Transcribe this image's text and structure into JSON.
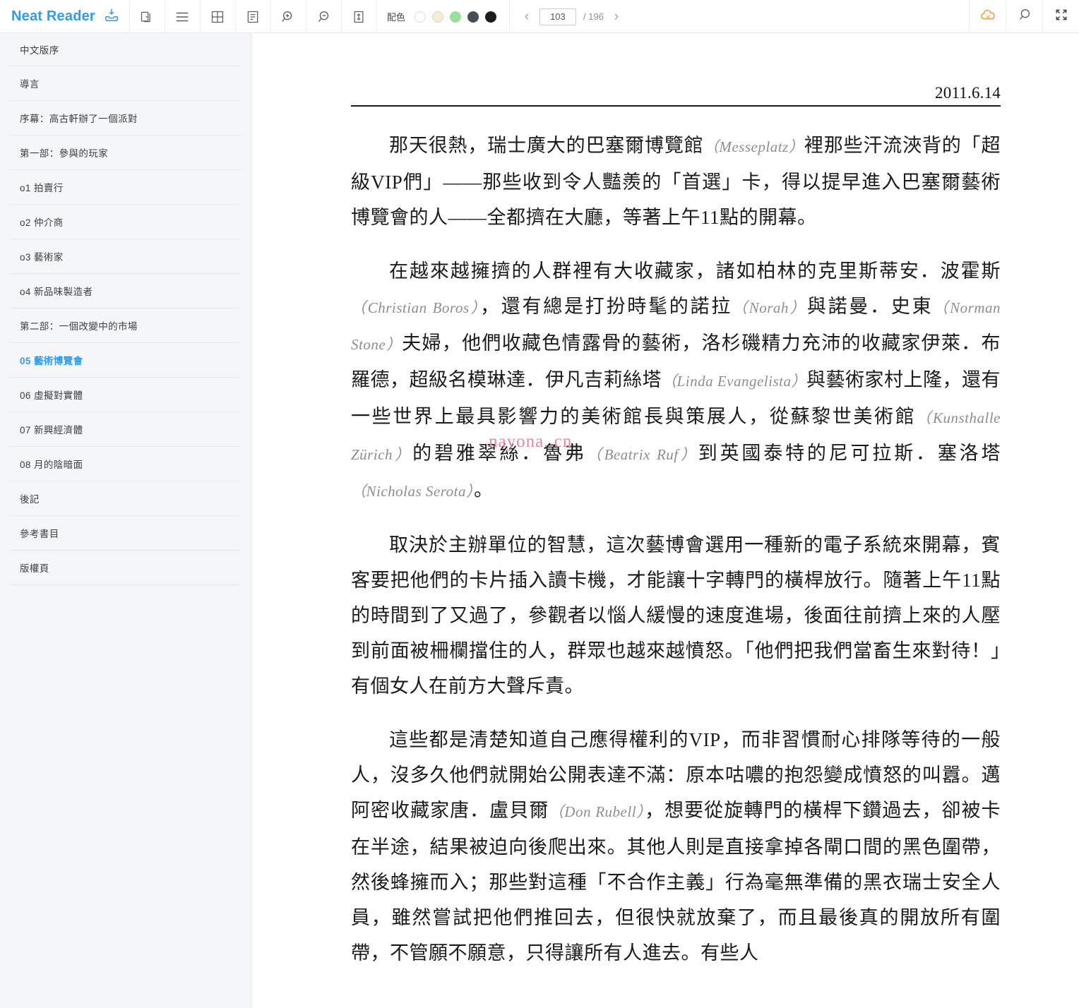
{
  "app": {
    "brand_name": "Neat Reader"
  },
  "toolbar": {
    "icons": [
      {
        "name": "save-to-library-icon",
        "label": "save-to-library"
      },
      {
        "name": "copy-book-icon",
        "label": "book-shelf"
      },
      {
        "name": "hamburger-menu-icon",
        "label": "menu"
      },
      {
        "name": "grid-layout-icon",
        "label": "grid-view"
      },
      {
        "name": "note-list-icon",
        "label": "notes"
      },
      {
        "name": "zoom-in-icon",
        "label": "zoom-in"
      },
      {
        "name": "zoom-out-icon",
        "label": "zoom-out"
      },
      {
        "name": "line-height-icon",
        "label": "line-spacing"
      }
    ],
    "palette_label": "配色",
    "swatches": [
      {
        "name": "theme-white",
        "color": "#ffffff",
        "border": "#d8dade"
      },
      {
        "name": "theme-sepia",
        "color": "#f3ecd9",
        "border": "#dcd3bd"
      },
      {
        "name": "theme-green",
        "color": "#9adf9a",
        "border": "#9adf9a"
      },
      {
        "name": "theme-dark-gray",
        "color": "#4a4f54",
        "border": "#4a4f54"
      },
      {
        "name": "theme-black",
        "color": "#1c1c1c",
        "border": "#1c1c1c"
      }
    ],
    "pager": {
      "prev_label": "‹",
      "next_label": "›",
      "current_page": "103",
      "total_label": "/ 196"
    },
    "right_icons": [
      {
        "name": "cloud-sync-icon",
        "label": "cloud-sync",
        "color": "#f29b38"
      },
      {
        "name": "search-icon",
        "label": "search"
      },
      {
        "name": "fullscreen-icon",
        "label": "fullscreen"
      }
    ]
  },
  "sidebar": {
    "items": [
      {
        "label": "中文版序",
        "active": false
      },
      {
        "label": "導言",
        "active": false
      },
      {
        "label": "序幕：高古軒辦了一個派對",
        "active": false
      },
      {
        "label": "第一部：參與的玩家",
        "active": false
      },
      {
        "label": "o1 拍賣行",
        "active": false
      },
      {
        "label": "o2 仲介商",
        "active": false
      },
      {
        "label": "o3 藝術家",
        "active": false
      },
      {
        "label": "o4 新品味製造者",
        "active": false
      },
      {
        "label": "第二部：一個改變中的市場",
        "active": false
      },
      {
        "label": "05 藝術博覽會",
        "active": true
      },
      {
        "label": "06 虛擬對實體",
        "active": false
      },
      {
        "label": "07 新興經濟體",
        "active": false
      },
      {
        "label": "08 月的陰暗面",
        "active": false
      },
      {
        "label": "後記",
        "active": false
      },
      {
        "label": "參考書目",
        "active": false
      },
      {
        "label": "版權頁",
        "active": false
      }
    ]
  },
  "reader": {
    "chapter_date": "2011.6.14",
    "watermark": "nayona. cn",
    "paragraphs": [
      {
        "id": "p1",
        "runs": [
          {
            "t": "cjk",
            "text": "那天很熱，瑞士廣大的巴塞爾博覽館"
          },
          {
            "t": "latin",
            "text": "（Messeplatz）"
          },
          {
            "t": "cjk",
            "text": "裡那些汗流浹背的「超級VIP們」——那些收到令人豔羨的「首選」卡，得以提早進入巴塞爾藝術博覽會的人——全都擠在大廳，等著上午11點的開幕。"
          }
        ]
      },
      {
        "id": "p2",
        "runs": [
          {
            "t": "cjk",
            "text": "在越來越擁擠的人群裡有大收藏家，諸如柏林的克里斯蒂安．波霍斯"
          },
          {
            "t": "latin",
            "text": "（Christian Boros）"
          },
          {
            "t": "cjk",
            "text": "，還有總是打扮時髦的諾拉"
          },
          {
            "t": "latin",
            "text": "（Norah）"
          },
          {
            "t": "cjk",
            "text": "與諾曼．史東"
          },
          {
            "t": "latin",
            "text": "（Norman Stone）"
          },
          {
            "t": "cjk",
            "text": "夫婦，他們收藏色情露骨的藝術，洛杉磯精力充沛的收藏家伊萊．布羅德，超級名模琳達．伊凡吉莉絲塔"
          },
          {
            "t": "latin",
            "text": "（Linda Evangelista）"
          },
          {
            "t": "cjk",
            "text": "與藝術家村上隆，還有一些世界上最具影響力的美術館長與策展人，從蘇黎世美術館"
          },
          {
            "t": "latin",
            "text": "（Kunsthalle Zürich）"
          },
          {
            "t": "cjk",
            "text": "的碧雅翠絲．魯弗"
          },
          {
            "t": "latin",
            "text": "（Beatrix Ruf）"
          },
          {
            "t": "cjk",
            "text": "到英國泰特的尼可拉斯．塞洛塔"
          },
          {
            "t": "latin",
            "text": "（Nicholas Serota）"
          },
          {
            "t": "cjk",
            "text": "。"
          }
        ]
      },
      {
        "id": "p3",
        "runs": [
          {
            "t": "cjk",
            "text": "取決於主辦單位的智慧，這次藝博會選用一種新的電子系統來開幕，賓客要把他們的卡片插入讀卡機，才能讓十字轉門的橫桿放行。隨著上午11點的時間到了又過了，參觀者以惱人緩慢的速度進場，後面往前擠上來的人壓到前面被柵欄擋住的人，群眾也越來越憤怒。「他們把我們當畜生來對待！」有個女人在前方大聲斥責。"
          }
        ]
      },
      {
        "id": "p4",
        "runs": [
          {
            "t": "cjk",
            "text": "這些都是清楚知道自己應得權利的VIP，而非習慣耐心排隊等待的一般人，沒多久他們就開始公開表達不滿：原本咕噥的抱怨變成憤怒的叫囂。邁阿密收藏家唐．盧貝爾"
          },
          {
            "t": "latin",
            "text": "（Don Rubell）"
          },
          {
            "t": "cjk",
            "text": "，想要從旋轉門的橫桿下鑽過去，卻被卡在半途，結果被迫向後爬出來。其他人則是直接拿掉各閘口間的黑色圍帶，然後蜂擁而入；那些對這種「不合作主義」行為毫無準備的黑衣瑞士安全人員，雖然嘗試把他們推回去，但很快就放棄了，而且最後真的開放所有圍帶，不管願不願意，只得讓所有人進去。有些人"
          }
        ]
      }
    ]
  }
}
